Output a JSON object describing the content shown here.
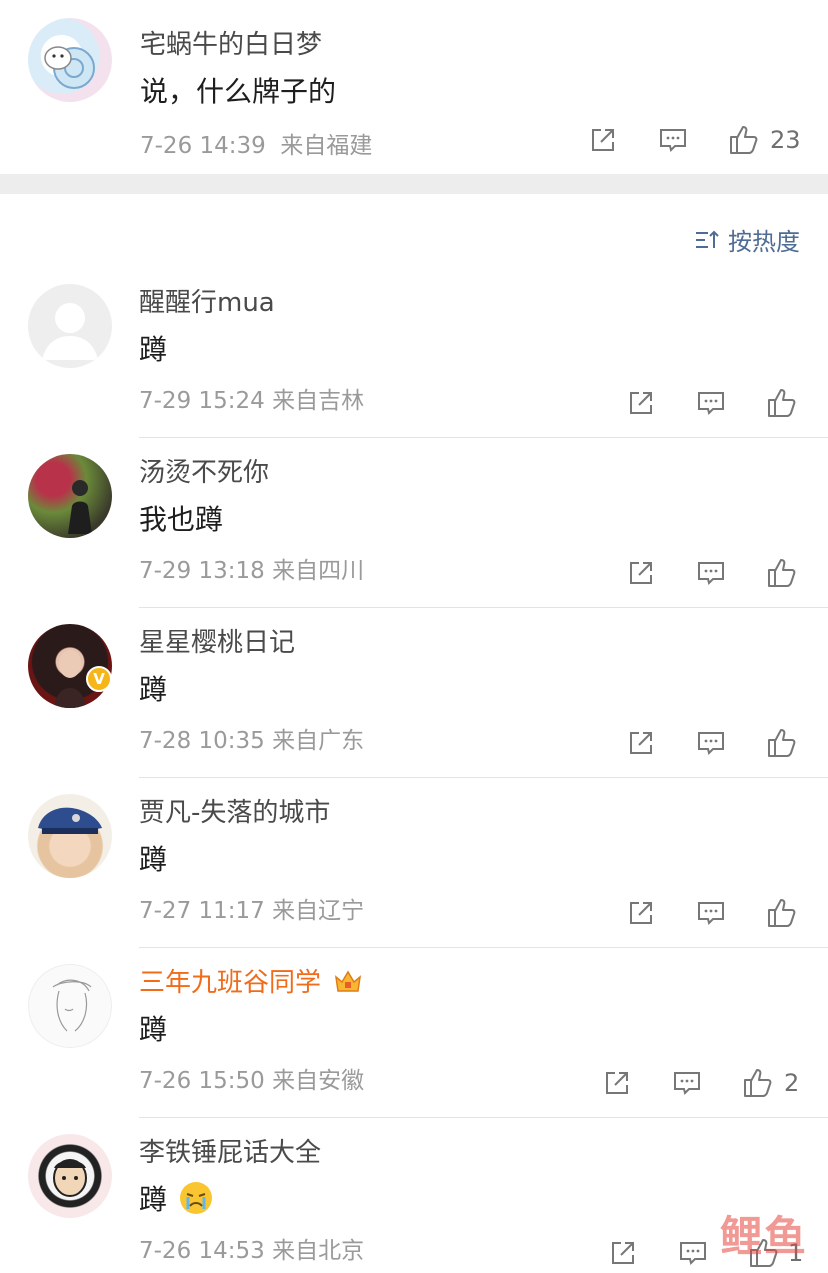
{
  "post": {
    "user": "宅蜗牛的白日梦",
    "text": "说，什么牌子的",
    "time": "7-26 14:39",
    "location": "来自福建",
    "like_count": "23"
  },
  "sort_label": "按热度",
  "comments": [
    {
      "user": "醒醒行mua",
      "text": "蹲",
      "time": "7-29 15:24",
      "location": "来自吉林",
      "likes": ""
    },
    {
      "user": "汤烫不死你",
      "text": "我也蹲",
      "time": "7-29 13:18",
      "location": "来自四川",
      "likes": ""
    },
    {
      "user": "星星樱桃日记",
      "text": "蹲",
      "time": "7-28 10:35",
      "location": "来自广东",
      "likes": "",
      "verified": "V"
    },
    {
      "user": "贾凡-失落的城市",
      "text": "蹲",
      "time": "7-27 11:17",
      "location": "来自辽宁",
      "likes": ""
    },
    {
      "user": "三年九班谷同学",
      "text": "蹲",
      "time": "7-26 15:50",
      "location": "来自安徽",
      "likes": "2"
    },
    {
      "user": "李铁锤屁话大全",
      "text": "蹲",
      "time": "7-26 14:53",
      "location": "来自北京",
      "likes": "1"
    }
  ],
  "watermark": "鲤鱼",
  "colors": {
    "link": "#4f6d94",
    "vip_name": "#f06c1a",
    "meta": "#9a9a9a",
    "band": "#ededed"
  }
}
